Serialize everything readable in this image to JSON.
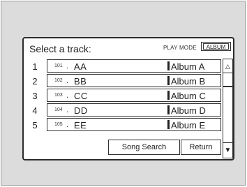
{
  "header": {
    "title": "Select a track:",
    "play_mode_label": "PLAY MODE",
    "play_mode_button": "ALBUM"
  },
  "tracks": [
    {
      "index": "1",
      "track_no": "101",
      "name": "AA",
      "album": "Album A"
    },
    {
      "index": "2",
      "track_no": "102",
      "name": "BB",
      "album": "Album B"
    },
    {
      "index": "3",
      "track_no": "103",
      "name": "CC",
      "album": "Album C"
    },
    {
      "index": "4",
      "track_no": "104",
      "name": "DD",
      "album": "Album D"
    },
    {
      "index": "5",
      "track_no": "105",
      "name": "EE",
      "album": "Album E"
    }
  ],
  "scrollbar": {
    "up_icon": "△",
    "down_icon": "▼"
  },
  "footer": {
    "song_search_label": "Song Search",
    "return_label": "Return"
  }
}
